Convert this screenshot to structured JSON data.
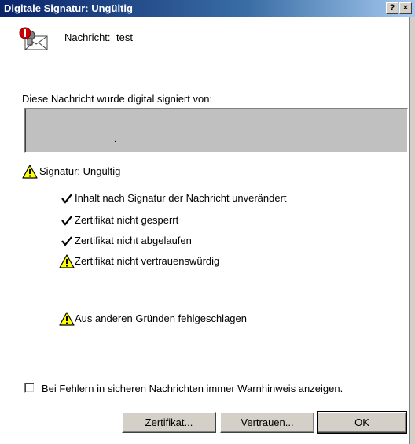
{
  "window": {
    "title": "Digitale Signatur: Ungültig",
    "help_glyph": "?",
    "close_glyph": "×"
  },
  "message": {
    "label": "Nachricht:",
    "value": "test"
  },
  "signed_by_label": "Diese Nachricht wurde digital signiert von:",
  "signer_box_text": ".",
  "signature_status": "Signatur: Ungültig",
  "checks": [
    {
      "status": "ok",
      "text": "Inhalt nach Signatur der Nachricht unverändert"
    },
    {
      "status": "ok",
      "text": "Zertifikat nicht gesperrt"
    },
    {
      "status": "ok",
      "text": "Zertifikat nicht abgelaufen"
    },
    {
      "status": "warning",
      "text": "Zertifikat nicht vertrauenswürdig"
    },
    {
      "status": "warning",
      "text": "Aus anderen Gründen fehlgeschlagen"
    }
  ],
  "warn_checkbox": {
    "checked": false,
    "label": "Bei Fehlern in sicheren Nachrichten immer Warnhinweis anzeigen."
  },
  "buttons": {
    "certificate": "Zertifikat...",
    "trust": "Vertrauen...",
    "ok": "OK"
  },
  "colors": {
    "titlebar_start": "#0a246a",
    "titlebar_end": "#a6caf0",
    "warning_yellow": "#ffff00",
    "button_face": "#d4d0c8"
  }
}
